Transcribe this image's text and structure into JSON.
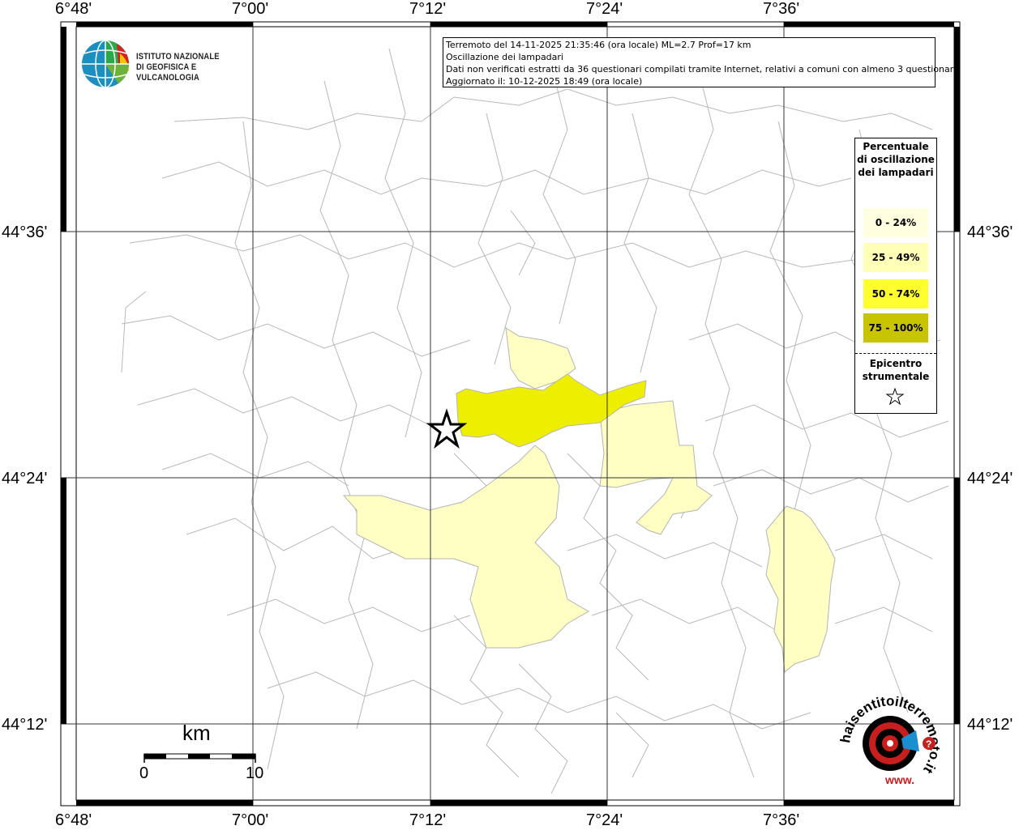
{
  "coords": {
    "lon_labels": [
      "6°48'",
      "7°00'",
      "7°12'",
      "7°24'",
      "7°36'"
    ],
    "lat_labels": [
      "44°36'",
      "44°24'",
      "44°12'"
    ]
  },
  "info": {
    "line1": "Terremoto del 14-11-2025 21:35:46 (ora locale) ML=2.7 Prof=17 km",
    "line2": "Oscillazione dei lampadari",
    "line3": "Dati non verificati estratti da 36 questionari compilati tramite Internet, relativi a comuni con almeno 3 questionari.",
    "line4": "Aggiornato il: 10-12-2025 18:49 (ora locale)"
  },
  "logo": {
    "line1": "ISTITUTO NAZIONALE",
    "line2": "DI GEOFISICA E VULCANOLOGIA"
  },
  "legend": {
    "title": "Percentuale di oscillazione dei lampadari",
    "items": [
      {
        "label": "0 - 24%",
        "color": "#ffffe0"
      },
      {
        "label": "25 - 49%",
        "color": "#ffffb8"
      },
      {
        "label": "50 - 74%",
        "color": "#ffff30"
      },
      {
        "label": "75 - 100%",
        "color": "#c8c400"
      }
    ],
    "epicenter_label": "Epicentro strumentale"
  },
  "scale": {
    "unit": "km",
    "start": "0",
    "end": "10"
  },
  "hsl_logo": {
    "text": "haisentitoilterremoto.it",
    "prefix": "www."
  },
  "colors": {
    "yellow_light": "#ffffc4",
    "yellow_strong": "#eeee00",
    "border_gray": "#b4b4b4",
    "grid": "#333333"
  }
}
